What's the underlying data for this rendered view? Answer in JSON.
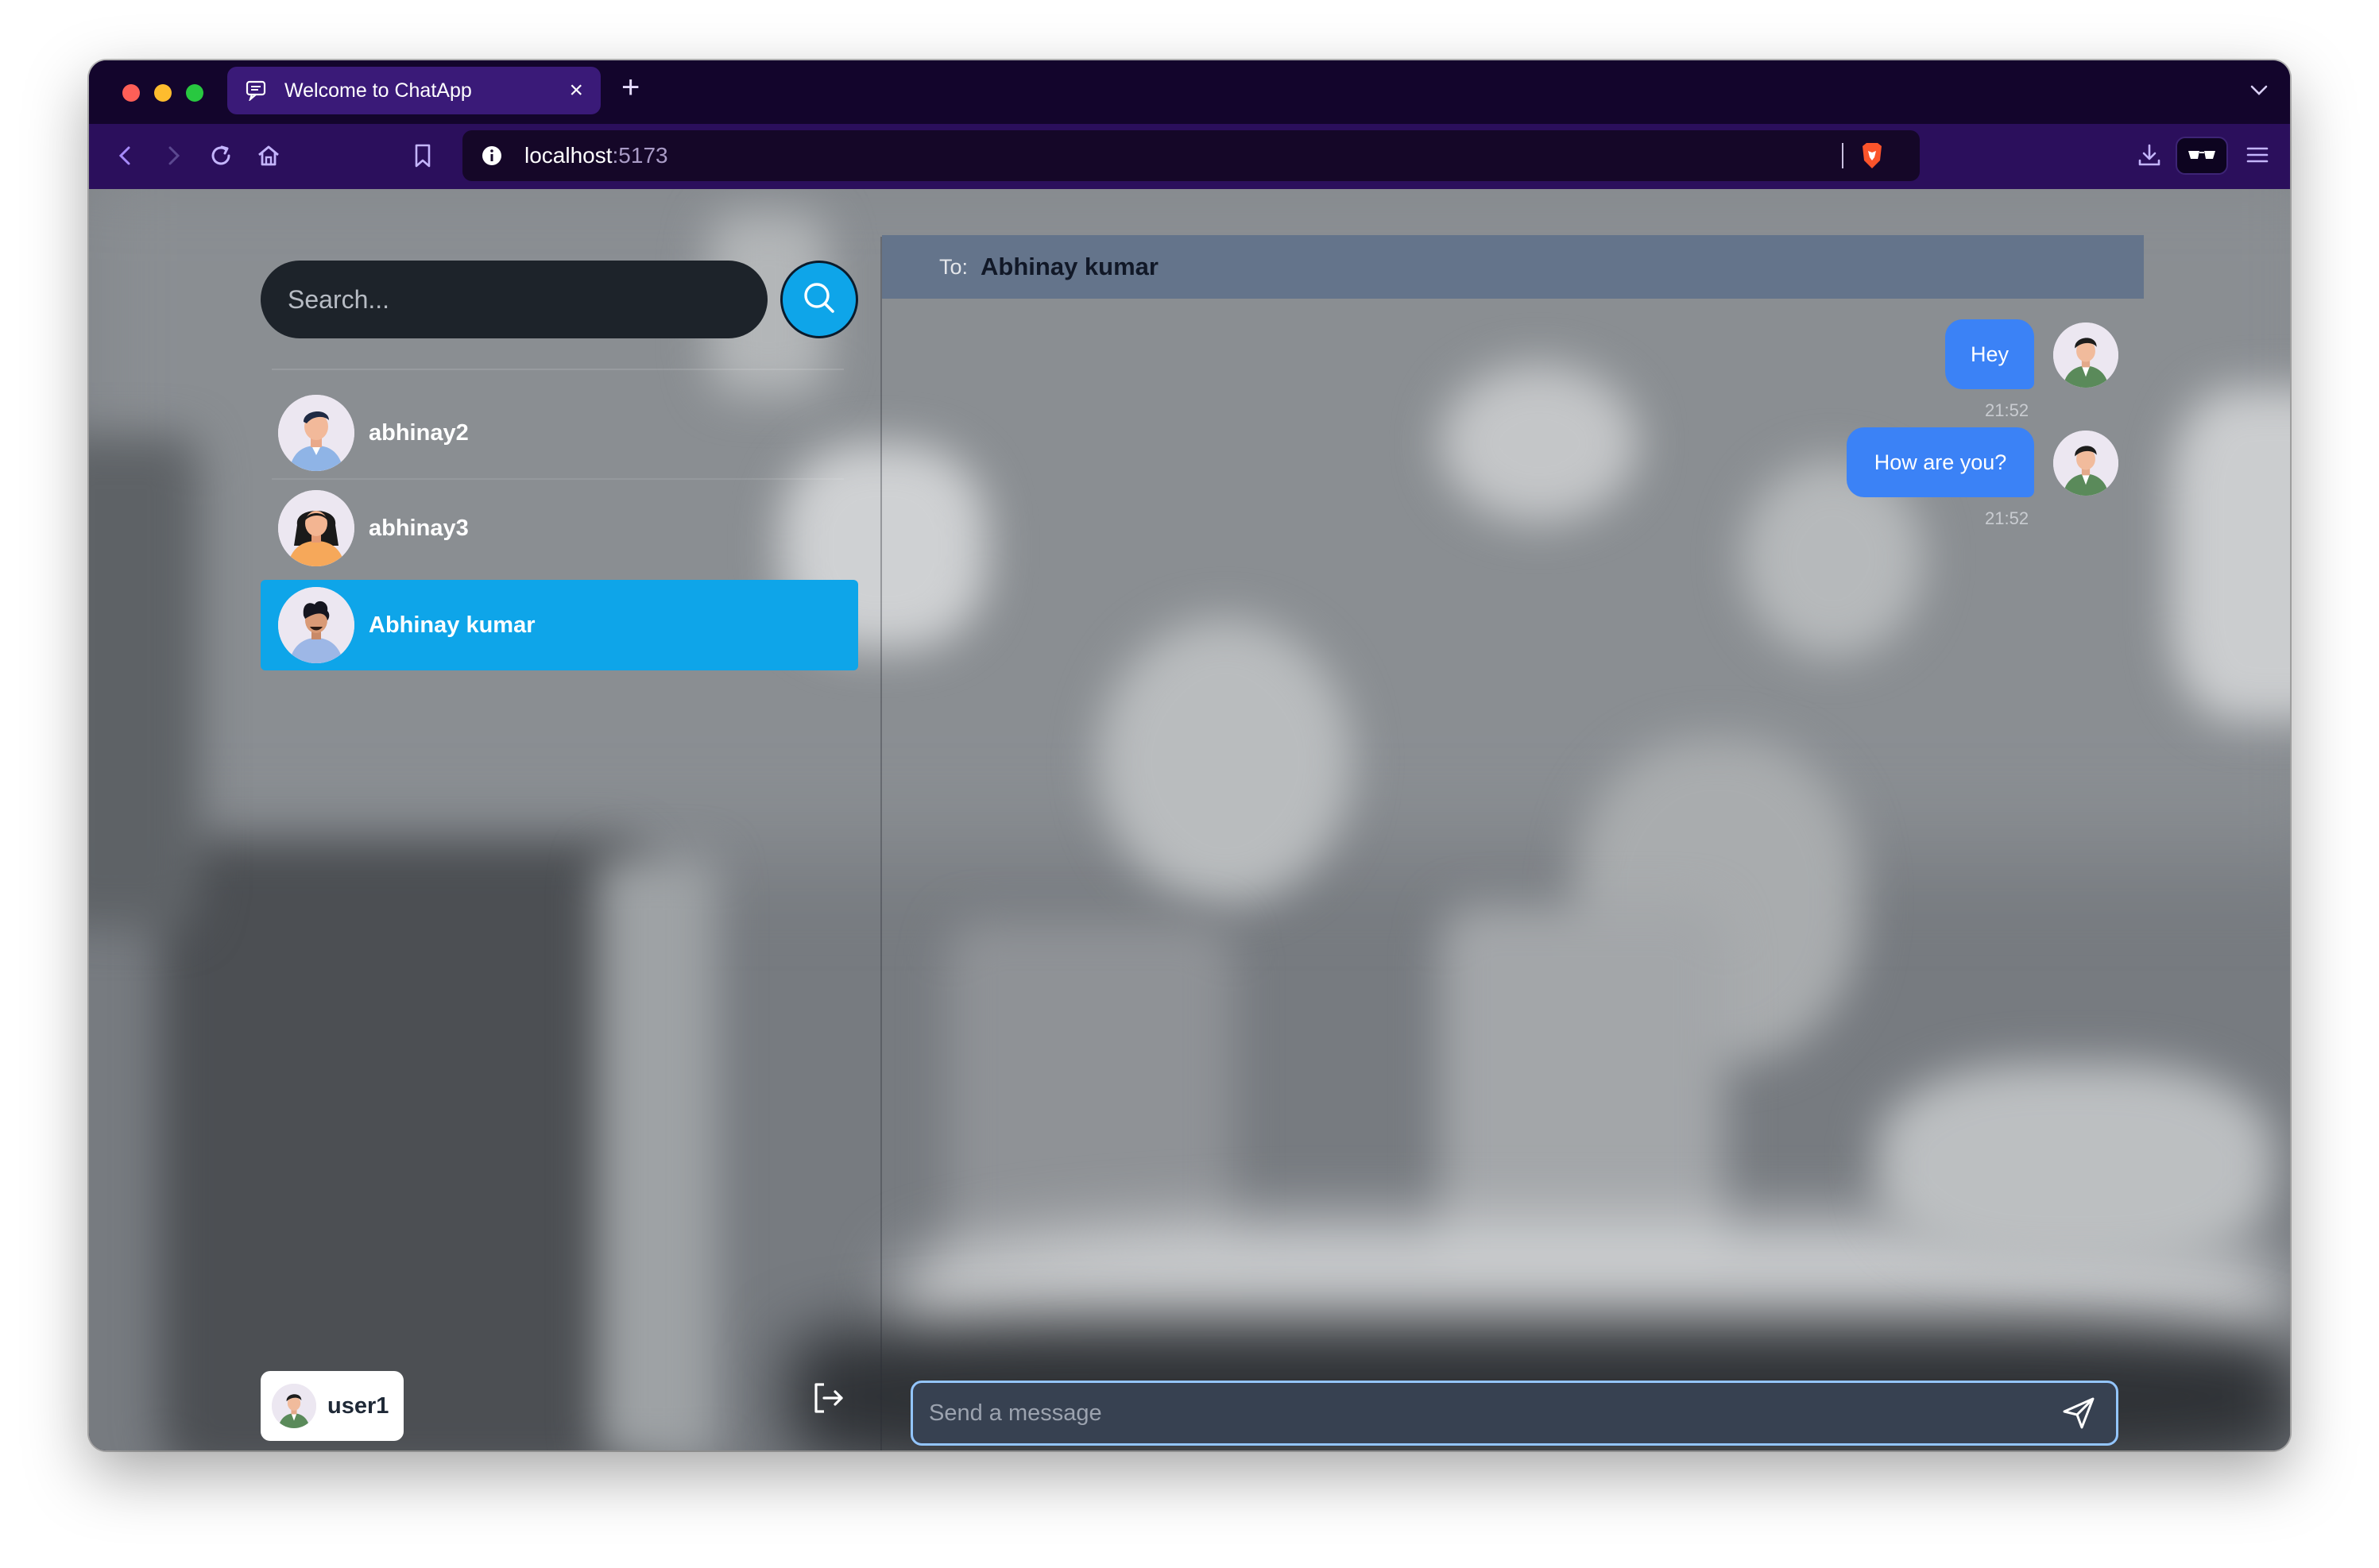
{
  "browser": {
    "tab_title": "Welcome to ChatApp",
    "tab_close": "×",
    "new_tab": "+",
    "url_host": "localhost",
    "url_port": ":5173"
  },
  "sidebar": {
    "search_placeholder": "Search...",
    "contacts": [
      {
        "name": "abhinay2",
        "avatar": "male-avatar",
        "selected": false
      },
      {
        "name": "abhinay3",
        "avatar": "female-avatar",
        "selected": false
      },
      {
        "name": "Abhinay kumar",
        "avatar": "male-curly-avatar",
        "selected": true
      }
    ],
    "current_user": "user1"
  },
  "chat": {
    "to_label": "To:",
    "recipient": "Abhinay kumar",
    "messages": [
      {
        "text": "Hey",
        "time": "21:52"
      },
      {
        "text": "How are you?",
        "time": "21:52"
      }
    ],
    "composer_placeholder": "Send a message"
  },
  "colors": {
    "accent": "#0ea5e9",
    "bubble": "#3b82f6",
    "header": "#64748b",
    "browser_chrome": "#2b0f5c"
  }
}
